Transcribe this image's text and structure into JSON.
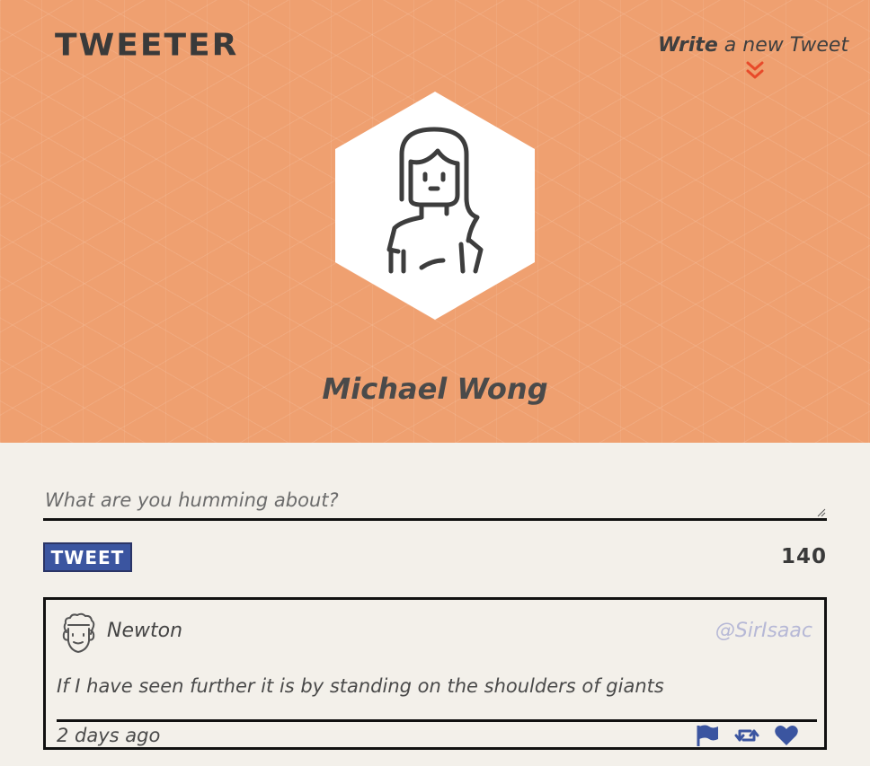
{
  "header": {
    "brand": "TWEETER",
    "compose_toggle": {
      "bold": "Write",
      "rest": " a new Tweet"
    },
    "profile_name": "Michael Wong",
    "background_color": "#efa070"
  },
  "compose": {
    "placeholder": "What are you humming about?",
    "value": "",
    "button_label": "TWEET",
    "counter": "140",
    "button_color": "#3b55a0"
  },
  "tweets": [
    {
      "author": "Newton",
      "handle": "@SirIsaac",
      "body": "If I have seen further it is by standing on the shoulders of giants",
      "time": "2 days ago",
      "actions": [
        "flag-icon",
        "retweet-icon",
        "heart-icon"
      ]
    }
  ],
  "colors": {
    "accent_chevron": "#e84a2a",
    "action_icons": "#3b55a0",
    "handle": "#b6b8d6"
  }
}
